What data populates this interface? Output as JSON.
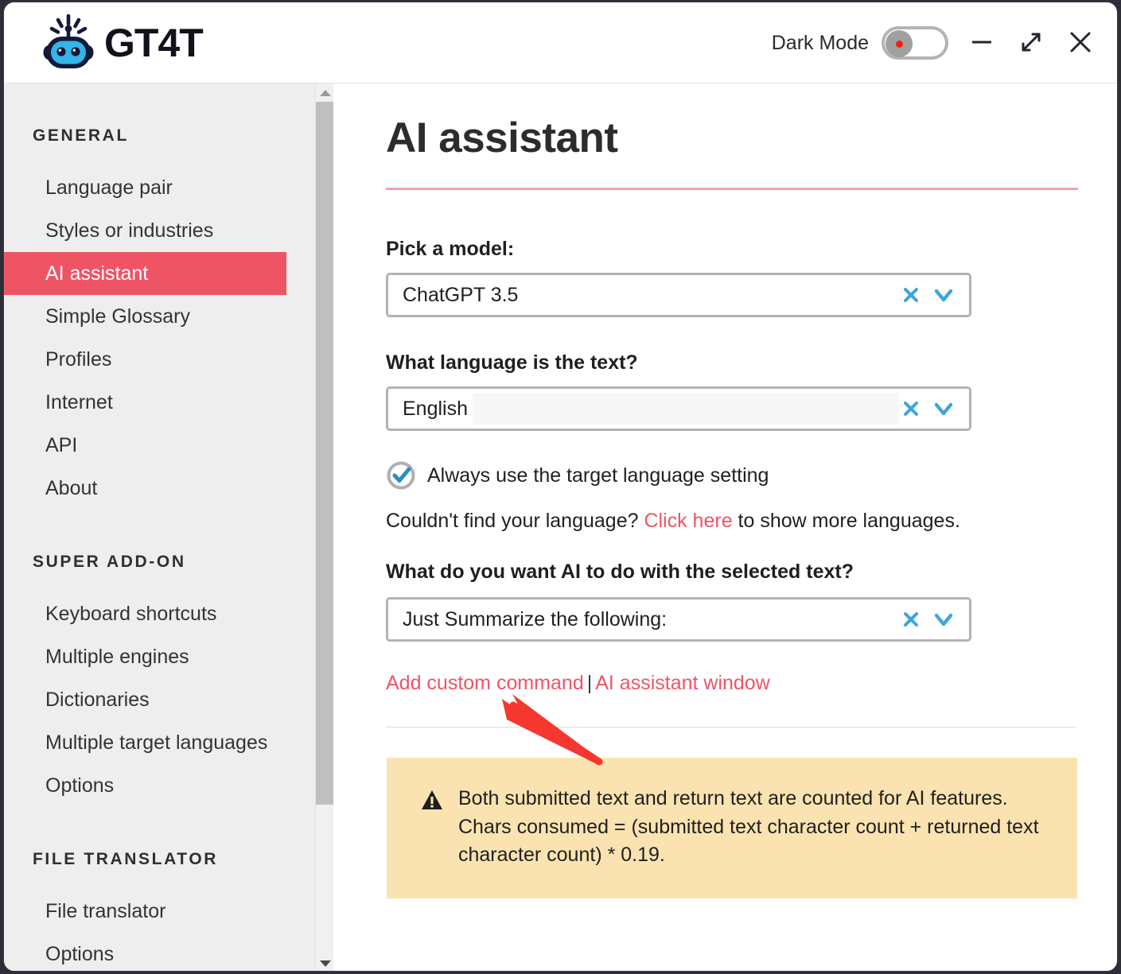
{
  "window": {
    "brand_name": "GT4T",
    "logo_icon": "robot-head-icon",
    "dark_mode_label": "Dark Mode",
    "dark_mode_on": false,
    "minimize_icon": "minimize-icon",
    "restore_icon": "maximize-restore-icon",
    "close_icon": "close-icon"
  },
  "sidebar": {
    "groups": [
      {
        "heading": "GENERAL",
        "items": [
          {
            "label": "Language pair",
            "active": false
          },
          {
            "label": "Styles or industries",
            "active": false
          },
          {
            "label": "AI assistant",
            "active": true
          },
          {
            "label": "Simple Glossary",
            "active": false
          },
          {
            "label": "Profiles",
            "active": false
          },
          {
            "label": "Internet",
            "active": false
          },
          {
            "label": "API",
            "active": false
          },
          {
            "label": "About",
            "active": false
          }
        ]
      },
      {
        "heading": "SUPER ADD-ON",
        "items": [
          {
            "label": "Keyboard shortcuts",
            "active": false
          },
          {
            "label": "Multiple engines",
            "active": false
          },
          {
            "label": "Dictionaries",
            "active": false
          },
          {
            "label": "Multiple target languages",
            "active": false
          },
          {
            "label": "Options",
            "active": false
          }
        ]
      },
      {
        "heading": "FILE TRANSLATOR",
        "items": [
          {
            "label": "File translator",
            "active": false
          },
          {
            "label": "Options",
            "active": false
          }
        ]
      }
    ],
    "scrollbar": {
      "up_icon": "scroll-up-arrow-icon",
      "down_icon": "scroll-down-arrow-icon"
    }
  },
  "main": {
    "title": "AI assistant",
    "model": {
      "label": "Pick a model:",
      "value": "ChatGPT 3.5",
      "clear_icon": "clear-x-icon",
      "expand_icon": "chevron-down-icon"
    },
    "language": {
      "label": "What language is the text?",
      "value": "English",
      "clear_icon": "clear-x-icon",
      "expand_icon": "chevron-down-icon"
    },
    "checkbox": {
      "label": "Always use the target language setting",
      "checked": true,
      "icon": "check-circle-icon"
    },
    "hint": {
      "prefix": "Couldn't find your language? ",
      "link": "Click here",
      "suffix": " to show more languages."
    },
    "command": {
      "label": "What do you want AI to do with the selected text?",
      "value": "Just Summarize the following:",
      "clear_icon": "clear-x-icon",
      "expand_icon": "chevron-down-icon"
    },
    "links": {
      "add_custom_command": "Add custom command",
      "separator": "|",
      "ai_assistant_window": "AI assistant window"
    },
    "notice": {
      "icon": "warning-triangle-icon",
      "text": "Both submitted text and return text are counted for AI features. Chars consumed = (submitted text character count + returned text character count) * 0.19."
    },
    "annotation": {
      "arrow_icon": "red-pointer-arrow-icon",
      "points_at": "Add custom command"
    }
  },
  "colors": {
    "accent_red": "#ef5465",
    "link_red": "#ef5465",
    "icon_blue": "#3da5dd",
    "notice_bg": "#fae3b0",
    "sidebar_bg": "#eeeeee",
    "annotation_red": "#f5382e"
  }
}
